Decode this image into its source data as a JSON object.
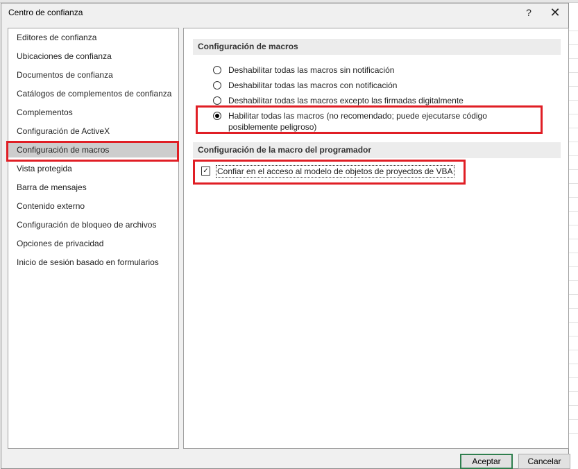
{
  "dialog": {
    "title": "Centro de confianza",
    "help": "?",
    "close": "✕"
  },
  "nav": {
    "items": [
      {
        "label": "Editores de confianza"
      },
      {
        "label": "Ubicaciones de confianza"
      },
      {
        "label": "Documentos de confianza"
      },
      {
        "label": "Catálogos de complementos de confianza"
      },
      {
        "label": "Complementos"
      },
      {
        "label": "Configuración de ActiveX"
      },
      {
        "label": "Configuración de macros"
      },
      {
        "label": "Vista protegida"
      },
      {
        "label": "Barra de mensajes"
      },
      {
        "label": "Contenido externo"
      },
      {
        "label": "Configuración de bloqueo de archivos"
      },
      {
        "label": "Opciones de privacidad"
      },
      {
        "label": "Inicio de sesión basado en formularios"
      }
    ],
    "selected": "Configuración de macros"
  },
  "macros": {
    "header": "Configuración de macros",
    "options": [
      {
        "label": "Deshabilitar todas las macros sin notificación",
        "checked": false
      },
      {
        "label": "Deshabilitar todas las macros con notificación",
        "checked": false
      },
      {
        "label": "Deshabilitar todas las macros excepto las firmadas digitalmente",
        "checked": false
      },
      {
        "label": "Habilitar todas las macros (no recomendado; puede ejecutarse código posiblemente peligroso)",
        "checked": true
      }
    ]
  },
  "developer": {
    "header": "Configuración de la macro del programador",
    "vba_label": "Confiar en el acceso al modelo de objetos de proyectos de VBA",
    "vba_checked": true,
    "check_glyph": "✓"
  },
  "buttons": {
    "ok": "Aceptar",
    "cancel": "Cancelar"
  },
  "colors": {
    "highlight": "#e01e25",
    "selected_bg": "#cdcdcd",
    "default_button_border": "#2f7f4e"
  }
}
